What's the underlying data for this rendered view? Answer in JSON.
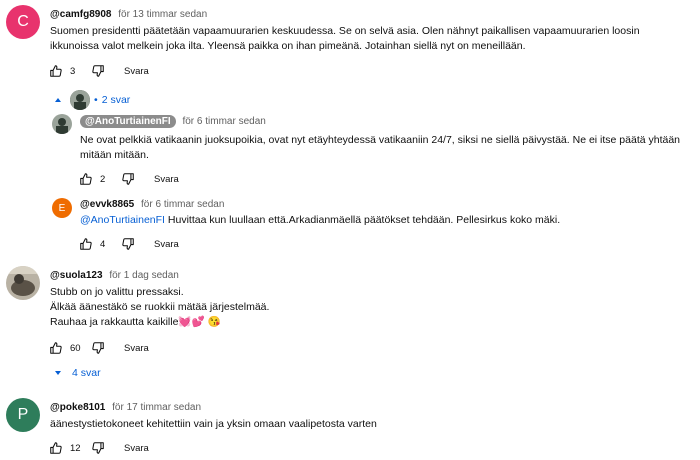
{
  "comments": [
    {
      "author": "@camfg8908",
      "time": "för 13 timmar sedan",
      "avatar_letter": "C",
      "avatar_color": "#e8336d",
      "text_lines": [
        "Suomen presidentti päätetään vapaamuurarien keskuudessa. Se on selvä asia. Olen nähnyt paikallisen vapaamuurarien loosin",
        "ikkunoissa valot melkein joka ilta. Yleensä paikka on ihan pimeänä. Jotainhan siellä nyt on meneillään."
      ],
      "likes": "3",
      "reply_label": "Svara",
      "replies_toggle": "2 svar",
      "replies": [
        {
          "author": "@AnoTurtiainenFI",
          "time": "för 6 timmar sedan",
          "text_lines": [
            "Ne ovat pelkkiä vatikaanin juoksupoikia, ovat nyt etäyhteydessä vatikaaniin 24/7, siksi ne siellä päivystää. Ne ei itse päätä yhtään",
            "mitään mitään."
          ],
          "likes": "2",
          "reply_label": "Svara"
        },
        {
          "author": "@evvk8865",
          "time": "för 6 timmar sedan",
          "avatar_letter": "E",
          "avatar_color": "#ef6c00",
          "mention": "@AnoTurtiainenFI",
          "text": " Huvittaa kun luullaan että.Arkadianmäellä päätökset tehdään. Pellesirkus koko mäki.",
          "likes": "4",
          "reply_label": "Svara"
        }
      ]
    },
    {
      "author": "@suola123",
      "time": "för 1 dag sedan",
      "text_lines": [
        "Stubb on jo valittu pressaksi.",
        "Älkää äänestäkö se ruokkii mätää järjestelmää.",
        "Rauhaa ja rakkautta kaikille💓💕 😘"
      ],
      "likes": "60",
      "reply_label": "Svara",
      "replies_toggle": "4 svar"
    },
    {
      "author": "@poke8101",
      "time": "för 17 timmar sedan",
      "avatar_letter": "P",
      "avatar_color": "#2e7d5b",
      "text_lines": [
        "äänestystietokoneet kehitettiin vain ja yksin omaan vaalipetosta varten"
      ],
      "likes": "12",
      "reply_label": "Svara"
    }
  ]
}
